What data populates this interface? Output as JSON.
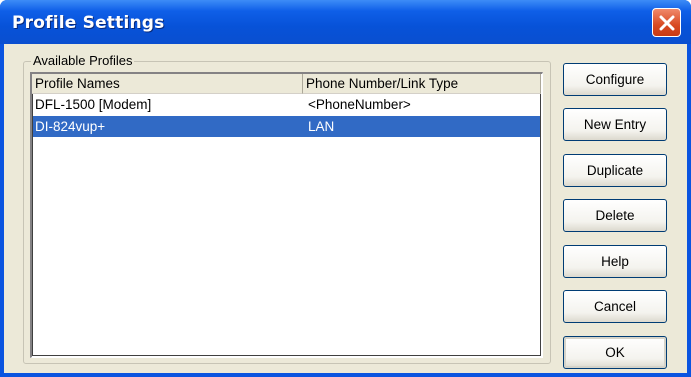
{
  "window": {
    "title": "Profile Settings"
  },
  "group": {
    "label": "Available Profiles"
  },
  "list": {
    "columns": [
      "Profile Names",
      "Phone Number/Link Type"
    ],
    "rows": [
      {
        "name": "DFL-1500 [Modem]",
        "type": "<PhoneNumber>",
        "selected": false
      },
      {
        "name": "DI-824vup+",
        "type": "LAN",
        "selected": true
      }
    ]
  },
  "buttons": {
    "configure": "Configure",
    "new_entry": "New Entry",
    "duplicate": "Duplicate",
    "delete": "Delete",
    "help": "Help",
    "cancel": "Cancel",
    "ok": "OK"
  },
  "colors": {
    "titlebar": "#0a54e0",
    "selection": "#316ac5",
    "close": "#d84a22",
    "dialog": "#ece9d8"
  },
  "icons": {
    "close": "close-x-icon"
  }
}
